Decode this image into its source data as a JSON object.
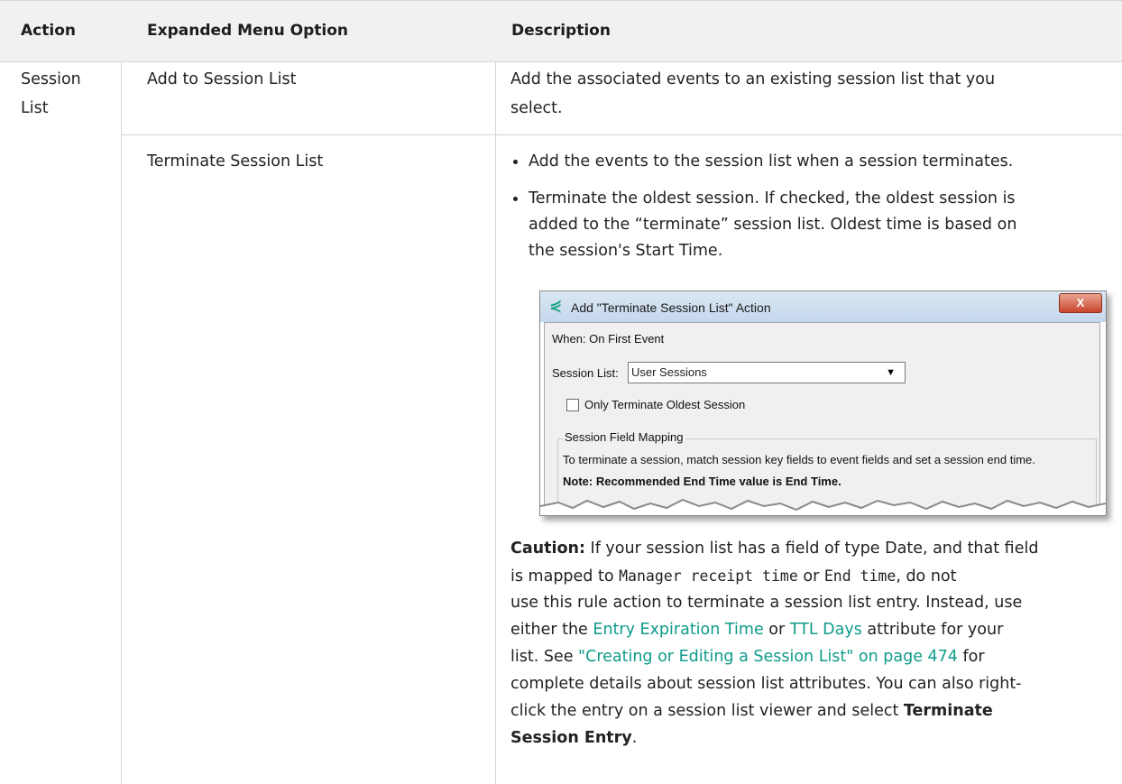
{
  "header": {
    "col1": "Action",
    "col2": "Expanded Menu Option",
    "col3": "Description"
  },
  "rows": [
    {
      "action": "Session List",
      "action_line1": "Session",
      "action_line2": "List",
      "option": "Add to Session List",
      "description_line1": "Add the associated events to an existing session list that you",
      "description_line2": "select."
    },
    {
      "option": "Terminate Session List",
      "bullets": [
        [
          "Add the events to the session list when a session terminates."
        ],
        [
          "Terminate the oldest session. If checked, the oldest session is",
          "added to the “terminate” session list. Oldest time is based on",
          "the session's Start Time."
        ]
      ]
    }
  ],
  "dialog": {
    "title": "Add \"Terminate Session List\" Action",
    "close_glyph": "X",
    "when": "When: On First Event",
    "session_list_label": "Session List:",
    "session_list_value": "User Sessions",
    "checkbox_label": "Only Terminate Oldest Session",
    "group_title": "Session Field Mapping",
    "group_text": "To terminate a session, match session key fields to event fields and set a session end time.",
    "note": "Note: Recommended End Time value is End Time."
  },
  "caution": {
    "label": "Caution:",
    "l1": " If your session list has a field of type Date, and that field",
    "l2a": "is mapped to ",
    "l2_code1": "Manager receipt time",
    "l2b": " or ",
    "l2_code2": "End time",
    "l2c": ", do not",
    "l3": "use this rule action to terminate a session list entry. Instead, use",
    "l4a": "either the ",
    "l4_link1": "Entry Expiration Time",
    "l4b": " or ",
    "l4_link2": "TTL Days",
    "l4c": " attribute for your",
    "l5a": "list. See ",
    "l5_link": "\"Creating or Editing a Session List\" on page 474",
    "l5b": " for",
    "l6": "complete details about session list attributes. You can also right-",
    "l7a": "click the entry on a session list viewer and select ",
    "l7_bold": "Terminate",
    "l8_bold": "Session Entry",
    "l8b": "."
  },
  "colors": {
    "link": "#0e9b8a",
    "header_bg": "#f1f1f1",
    "rule": "#d4d4d4"
  }
}
